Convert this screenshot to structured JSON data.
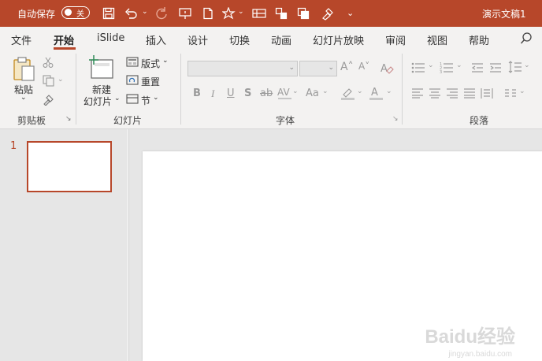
{
  "titlebar": {
    "autosave_label": "自动保存",
    "autosave_state": "关",
    "doc_title": "演示文稿1",
    "bg_color": "#b7472a",
    "icons": [
      "save-icon",
      "undo-icon",
      "redo-icon",
      "present-icon",
      "new-icon",
      "shapes-icon",
      "table-icon",
      "arrange-icon",
      "copy-icon",
      "format-painter-icon",
      "more-icon"
    ]
  },
  "tabs": [
    "文件",
    "开始",
    "iSlide",
    "插入",
    "设计",
    "切换",
    "动画",
    "幻灯片放映",
    "审阅",
    "视图",
    "帮助"
  ],
  "active_tab": "开始",
  "ribbon": {
    "clipboard": {
      "paste_label": "粘贴",
      "group_label": "剪贴板"
    },
    "slides": {
      "new_slide_line1": "新建",
      "new_slide_line2": "幻灯片",
      "layout_label": "版式",
      "reset_label": "重置",
      "section_label": "节",
      "group_label": "幻灯片"
    },
    "font": {
      "group_label": "字体",
      "bold": "B",
      "italic": "I",
      "underline": "U",
      "shadow": "S",
      "strike": "ab",
      "case": "Aa"
    },
    "paragraph": {
      "group_label": "段落"
    }
  },
  "slides": [
    {
      "number": "1"
    }
  ],
  "watermark": {
    "brand": "Baidu经验",
    "url": "jingyan.baidu.com"
  }
}
